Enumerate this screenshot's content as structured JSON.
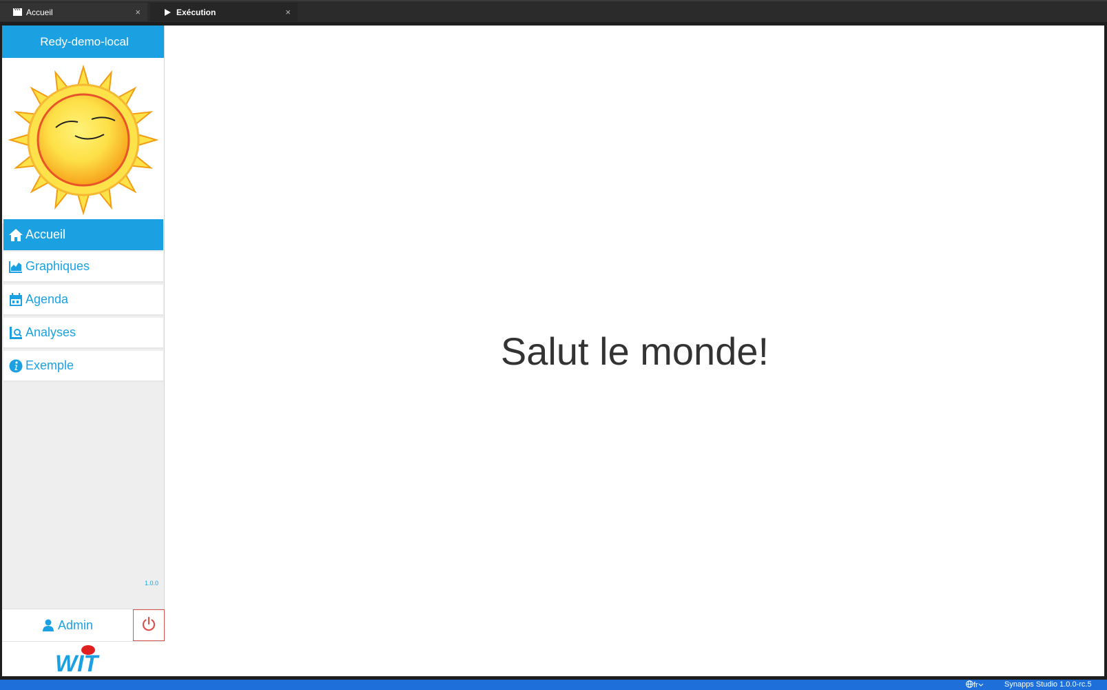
{
  "tabs": [
    {
      "label": "Accueil",
      "icon": "clapperboard-icon",
      "close": "×"
    },
    {
      "label": "Exécution",
      "icon": "play-icon",
      "close": "×"
    }
  ],
  "sidebar": {
    "title": "Redy-demo-local",
    "menu": [
      {
        "label": "Accueil",
        "icon": "home-icon"
      },
      {
        "label": "Graphiques",
        "icon": "area-chart-icon"
      },
      {
        "label": "Agenda",
        "icon": "calendar-icon"
      },
      {
        "label": "Analyses",
        "icon": "analysis-icon"
      },
      {
        "label": "Exemple",
        "icon": "info-icon"
      }
    ],
    "version": "1.0.0",
    "user": "Admin",
    "brand": "WIT"
  },
  "main": {
    "greeting": "Salut le monde!"
  },
  "statusbar": {
    "language": "fr",
    "studio": "Synapps Studio 1.0.0-rc.5"
  },
  "colors": {
    "accent": "#1ba1e2",
    "power": "#d9534f",
    "statusbar": "#1e6fd9"
  }
}
